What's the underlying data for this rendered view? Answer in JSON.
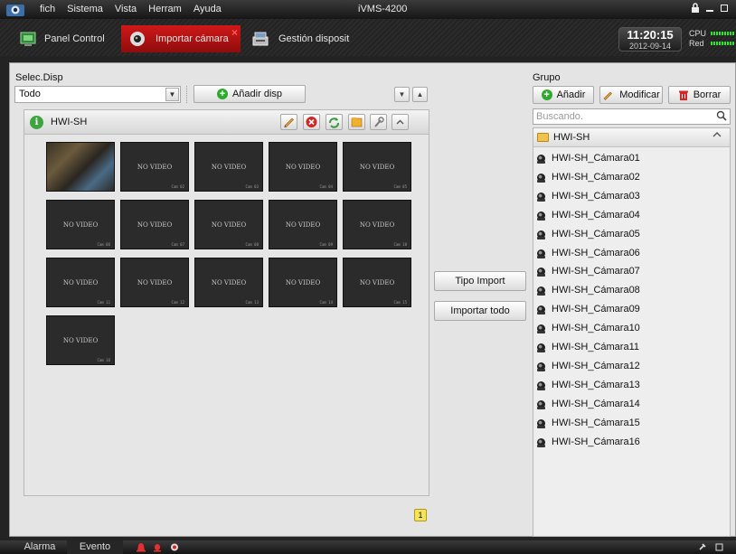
{
  "titlebar": {
    "menu": [
      "fich",
      "Sistema",
      "Vista",
      "Herram",
      "Ayuda"
    ],
    "title": "iVMS-4200"
  },
  "tabs": [
    {
      "label": "Panel Control",
      "icon": "panel-control-icon"
    },
    {
      "label": "Importar cámara",
      "icon": "camera-import-icon",
      "active": true
    },
    {
      "label": "Gestión disposit",
      "icon": "device-management-icon"
    }
  ],
  "status": {
    "time": "11:20:15",
    "date": "2012-09-14",
    "cpu_label": "CPU",
    "net_label": "Red"
  },
  "left": {
    "selec_label": "Selec.Disp",
    "device_select_value": "Todo",
    "add_device_label": "Añadir disp",
    "device_name": "HWI-SH"
  },
  "camera_grid": {
    "no_video_text": "NO VIDEO",
    "cells": [
      {
        "photo": true
      },
      {
        "corner": "Cam 02"
      },
      {
        "corner": "Cam 03"
      },
      {
        "corner": "Cam 04"
      },
      {
        "corner": "Cam 05"
      },
      {
        "corner": "Cam 06"
      },
      {
        "corner": "Cam 07"
      },
      {
        "corner": "Cam 08"
      },
      {
        "corner": "Cam 09"
      },
      {
        "corner": "Cam 10"
      },
      {
        "corner": "Cam 11"
      },
      {
        "corner": "Cam 12"
      },
      {
        "corner": "Cam 13"
      },
      {
        "corner": "Cam 14"
      },
      {
        "corner": "Cam 15"
      },
      {
        "corner": "Cam 16"
      }
    ]
  },
  "middle": {
    "tipo_import_label": "Tipo Import",
    "import_all_label": "Importar todo"
  },
  "pagination": {
    "current_page": "1"
  },
  "right": {
    "group_label": "Grupo",
    "add_label": "Añadir",
    "modify_label": "Modificar",
    "delete_label": "Borrar",
    "search_placeholder": "Buscando.",
    "group_name": "HWI-SH",
    "cameras": [
      "HWI-SH_Cámara01",
      "HWI-SH_Cámara02",
      "HWI-SH_Cámara03",
      "HWI-SH_Cámara04",
      "HWI-SH_Cámara05",
      "HWI-SH_Cámara06",
      "HWI-SH_Cámara07",
      "HWI-SH_Cámara08",
      "HWI-SH_Cámara09",
      "HWI-SH_Cámara10",
      "HWI-SH_Cámara11",
      "HWI-SH_Cámara12",
      "HWI-SH_Cámara13",
      "HWI-SH_Cámara14",
      "HWI-SH_Cámara15",
      "HWI-SH_Cámara16"
    ]
  },
  "bottombar": {
    "alarm_label": "Alarma",
    "event_label": "Evento"
  },
  "colors": {
    "active_tab": "#c41414",
    "add_green": "#2eaa2e",
    "delete_red": "#d42424",
    "meter_green": "#2ee62e"
  }
}
